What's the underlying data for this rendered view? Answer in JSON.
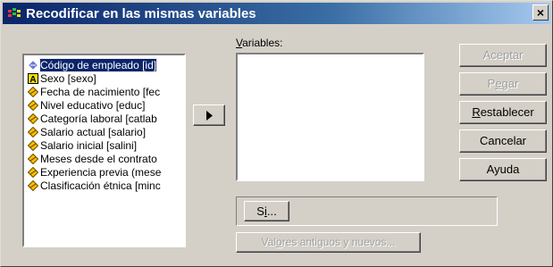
{
  "window": {
    "title": "Recodificar en las mismas variables",
    "close_glyph": "×"
  },
  "source_list": {
    "items": [
      {
        "label": "Código de empleado [id]",
        "icon": "nominal-ruler-icon",
        "selected": true
      },
      {
        "label": "Sexo [sexo]",
        "icon": "string-a-icon",
        "selected": false
      },
      {
        "label": "Fecha de nacimiento [fec",
        "icon": "scale-ruler-icon",
        "selected": false
      },
      {
        "label": "Nivel educativo [educ]",
        "icon": "scale-ruler-icon",
        "selected": false
      },
      {
        "label": "Categoría laboral [catlab",
        "icon": "scale-ruler-icon",
        "selected": false
      },
      {
        "label": "Salario actual [salario]",
        "icon": "scale-ruler-icon",
        "selected": false
      },
      {
        "label": "Salario inicial [salini]",
        "icon": "scale-ruler-icon",
        "selected": false
      },
      {
        "label": "Meses desde el contrato",
        "icon": "scale-ruler-icon",
        "selected": false
      },
      {
        "label": "Experiencia previa (mese",
        "icon": "scale-ruler-icon",
        "selected": false
      },
      {
        "label": "Clasificación étnica [minc",
        "icon": "scale-ruler-icon",
        "selected": false
      }
    ]
  },
  "variables_label": {
    "mnemonic": "V",
    "rest": "ariables:"
  },
  "buttons": {
    "aceptar": "Aceptar",
    "pegar": {
      "before": "P",
      "mnemonic": "e",
      "after": "gar"
    },
    "restablecer": {
      "before": "",
      "mnemonic": "R",
      "after": "establecer"
    },
    "cancelar": "Cancelar",
    "ayuda": "Ayuda",
    "si": {
      "before": "S",
      "mnemonic": "i",
      "after": "..."
    },
    "valores": {
      "before": "Val",
      "mnemonic": "o",
      "after": "res antiguos y nuevos..."
    }
  },
  "colors": {
    "selection": "#0a246a",
    "face": "#d4d0c8",
    "scale_icon": "#f0c000"
  }
}
